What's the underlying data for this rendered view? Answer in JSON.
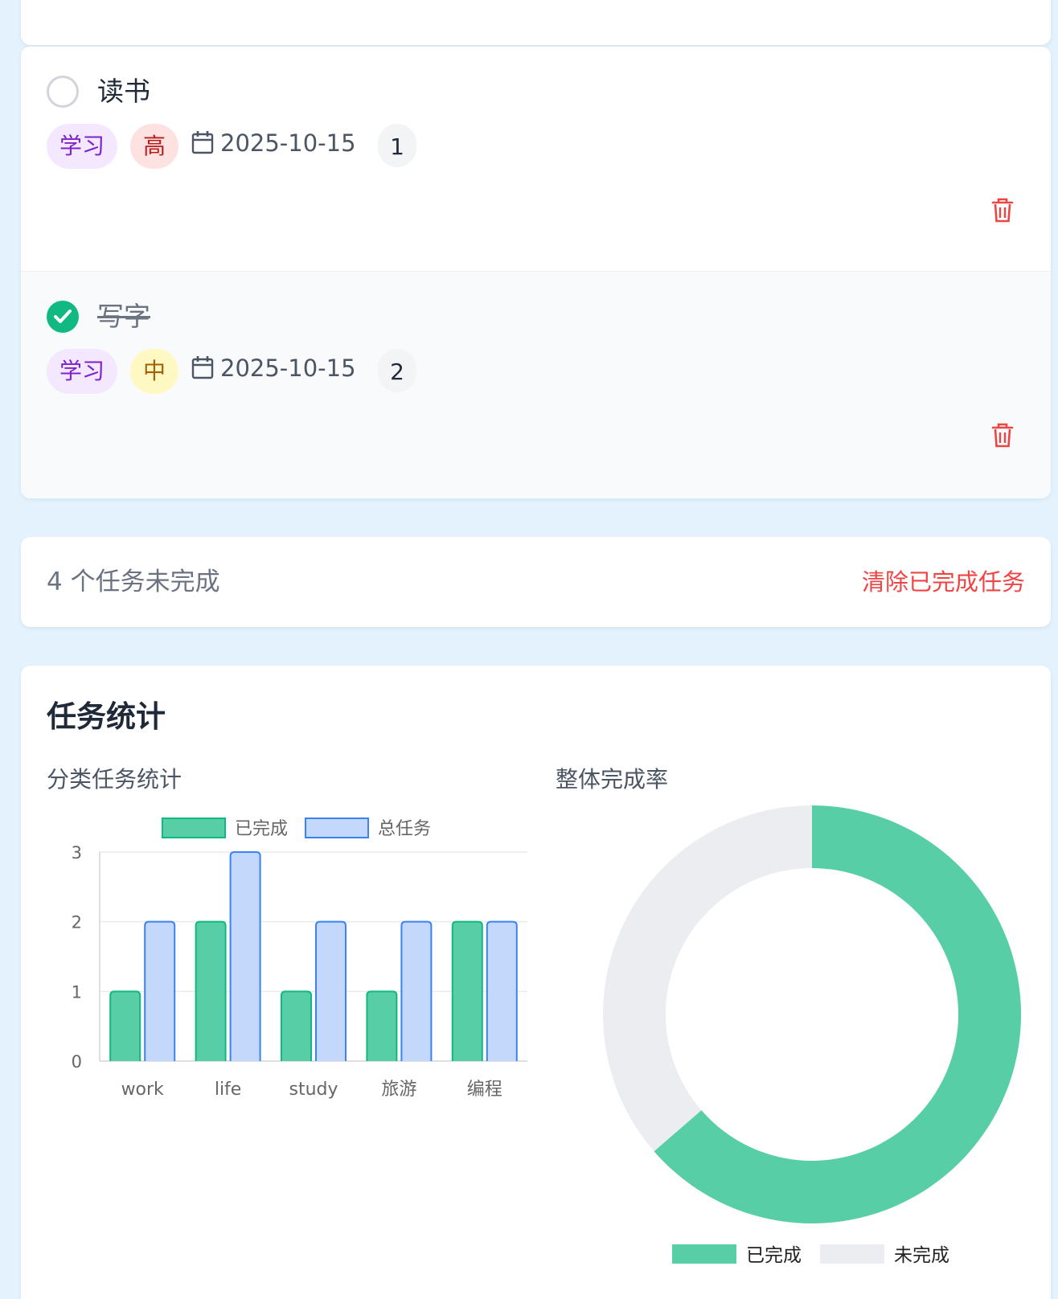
{
  "tasks": [
    {
      "title": "读书",
      "completed": false,
      "category": "学习",
      "priority": "高",
      "date": "2025-10-15",
      "count": "1"
    },
    {
      "title": "写字",
      "completed": true,
      "category": "学习",
      "priority": "中",
      "date": "2025-10-15",
      "count": "2"
    }
  ],
  "summary": {
    "remaining_text": "4 个任务未完成",
    "clear_completed_label": "清除已完成任务"
  },
  "stats": {
    "title": "任务统计",
    "bar_subtitle": "分类任务统计",
    "pie_subtitle": "整体完成率"
  },
  "colors": {
    "completed": "#57cea6",
    "completed_border": "#10b981",
    "total": "#c3d8fb",
    "total_border": "#3b82f6",
    "incomplete": "#ecedf0",
    "danger": "#ef4444",
    "check": "#10b981"
  },
  "chart_data": [
    {
      "type": "bar",
      "categories": [
        "work",
        "life",
        "study",
        "旅游",
        "编程"
      ],
      "series": [
        {
          "name": "已完成",
          "values": [
            1,
            2,
            1,
            1,
            2
          ]
        },
        {
          "name": "总任务",
          "values": [
            2,
            3,
            2,
            2,
            2
          ]
        }
      ],
      "ylim": [
        0,
        3
      ],
      "yticks": [
        0,
        1,
        2,
        3
      ],
      "legend": "top",
      "grid": true
    },
    {
      "type": "pie",
      "variant": "doughnut",
      "labels": [
        "已完成",
        "未完成"
      ],
      "values": [
        7,
        4
      ],
      "legend": "bottom"
    }
  ]
}
